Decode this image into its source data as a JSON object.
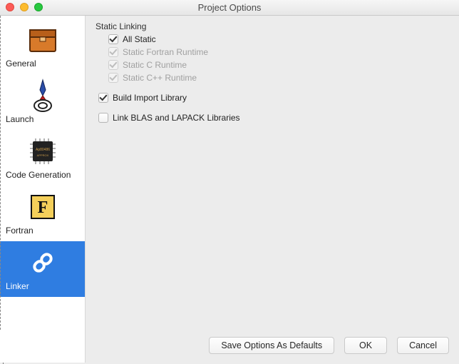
{
  "title": "Project Options",
  "sidebar": {
    "items": [
      {
        "label": "General"
      },
      {
        "label": "Launch"
      },
      {
        "label": "Code Generation"
      },
      {
        "label": "Fortran"
      },
      {
        "label": "Linker"
      }
    ]
  },
  "main": {
    "group_label": "Static Linking",
    "opts": {
      "all_static": "All Static",
      "fortran_rt": "Static Fortran Runtime",
      "c_rt": "Static C Runtime",
      "cpp_rt": "Static C++ Runtime",
      "build_import": "Build Import Library",
      "link_blas": "Link BLAS and LAPACK Libraries"
    }
  },
  "buttons": {
    "save_defaults": "Save Options As Defaults",
    "ok": "OK",
    "cancel": "Cancel"
  }
}
